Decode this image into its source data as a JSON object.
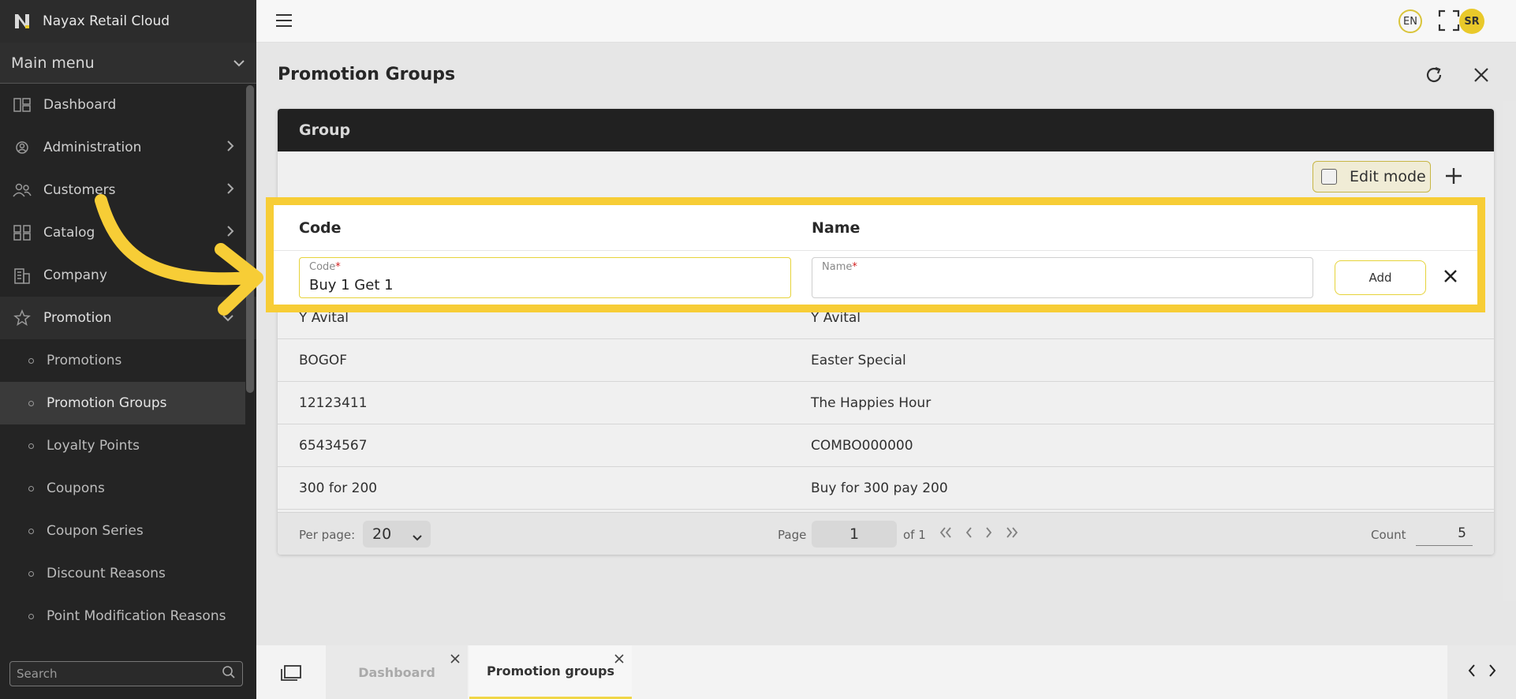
{
  "app": {
    "title": "Nayax Retail Cloud"
  },
  "sidebar": {
    "main_menu_label": "Main menu",
    "items": [
      {
        "label": "Dashboard",
        "icon": "dashboard-icon"
      },
      {
        "label": "Administration",
        "icon": "administration-icon"
      },
      {
        "label": "Customers",
        "icon": "customers-icon"
      },
      {
        "label": "Catalog",
        "icon": "catalog-icon"
      },
      {
        "label": "Company",
        "icon": "company-icon"
      },
      {
        "label": "Promotion",
        "icon": "star-icon"
      }
    ],
    "subitems": [
      {
        "label": "Promotions"
      },
      {
        "label": "Promotion Groups"
      },
      {
        "label": "Loyalty Points"
      },
      {
        "label": "Coupons"
      },
      {
        "label": "Coupon Series"
      },
      {
        "label": "Discount Reasons"
      },
      {
        "label": "Point Modification Reasons"
      }
    ],
    "search_placeholder": "Search"
  },
  "topbar": {
    "lang": "EN",
    "avatar_initials": "SR"
  },
  "page": {
    "title": "Promotion Groups",
    "card_header": "Group",
    "edit_mode_label": "Edit mode"
  },
  "table": {
    "headers": {
      "code": "Code",
      "name": "Name"
    },
    "new_row": {
      "code_label": "Code",
      "code_value": "Buy 1 Get 1",
      "name_label": "Name",
      "name_value": "",
      "required_mark": "*",
      "add_label": "Add"
    },
    "rows": [
      {
        "code": "Y Avital",
        "name": "Y Avital"
      },
      {
        "code": "BOGOF",
        "name": "Easter Special"
      },
      {
        "code": "12123411",
        "name": "The Happies Hour"
      },
      {
        "code": "65434567",
        "name": "COMBO000000"
      },
      {
        "code": "300 for 200",
        "name": "Buy for 300 pay 200"
      }
    ]
  },
  "footer": {
    "per_page_label": "Per page:",
    "per_page_value": "20",
    "page_label": "Page",
    "page_value": "1",
    "of_label": "of 1",
    "count_label": "Count",
    "count_value": "5"
  },
  "tabs": [
    {
      "label": "Dashboard"
    },
    {
      "label": "Promotion groups"
    }
  ],
  "colors": {
    "accent": "#f7cd36",
    "sidebar_bg": "#242424",
    "card_header_bg": "#242424"
  }
}
